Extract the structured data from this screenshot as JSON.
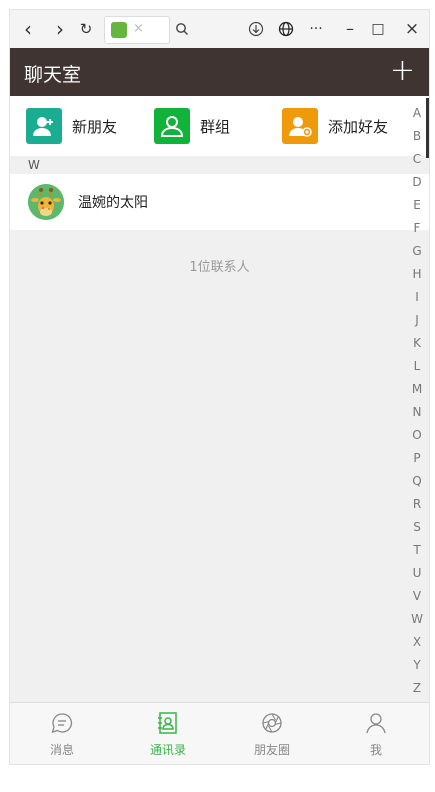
{
  "browser": {
    "nav_back": "‹",
    "nav_forward": "›",
    "nav_refresh": "↻",
    "tab_close": "×",
    "icons": [
      "back-icon",
      "forward-icon",
      "refresh-icon",
      "favicon",
      "search-icon",
      "download-icon",
      "globe-icon",
      "more-icon",
      "minimize-icon",
      "maximize-icon",
      "close-icon"
    ],
    "more": "···",
    "minimize": "–",
    "maximize": "□",
    "close": "×"
  },
  "header": {
    "title": "聊天室",
    "add": "+"
  },
  "actions": [
    {
      "label": "新朋友",
      "icon": "new-friend-icon",
      "color": "#1aad91"
    },
    {
      "label": "群组",
      "icon": "group-icon",
      "color": "#12b33a"
    },
    {
      "label": "添加好友",
      "icon": "add-friend-icon",
      "color": "#ef9a0a"
    }
  ],
  "section": {
    "letter": "W"
  },
  "contacts": [
    {
      "name": "温婉的太阳",
      "avatar": "giraffe-avatar"
    }
  ],
  "contact_count": "1位联系人",
  "index": [
    "A",
    "B",
    "C",
    "D",
    "E",
    "F",
    "G",
    "H",
    "I",
    "J",
    "K",
    "L",
    "M",
    "N",
    "O",
    "P",
    "Q",
    "R",
    "S",
    "T",
    "U",
    "V",
    "W",
    "X",
    "Y",
    "Z"
  ],
  "nav": [
    {
      "label": "消息",
      "icon": "message-icon",
      "active": false
    },
    {
      "label": "通讯录",
      "icon": "contacts-icon",
      "active": true
    },
    {
      "label": "朋友圈",
      "icon": "moments-icon",
      "active": false
    },
    {
      "label": "我",
      "icon": "profile-icon",
      "active": false
    }
  ],
  "colors": {
    "header_bg": "#3f3432",
    "active": "#3cb44b"
  }
}
